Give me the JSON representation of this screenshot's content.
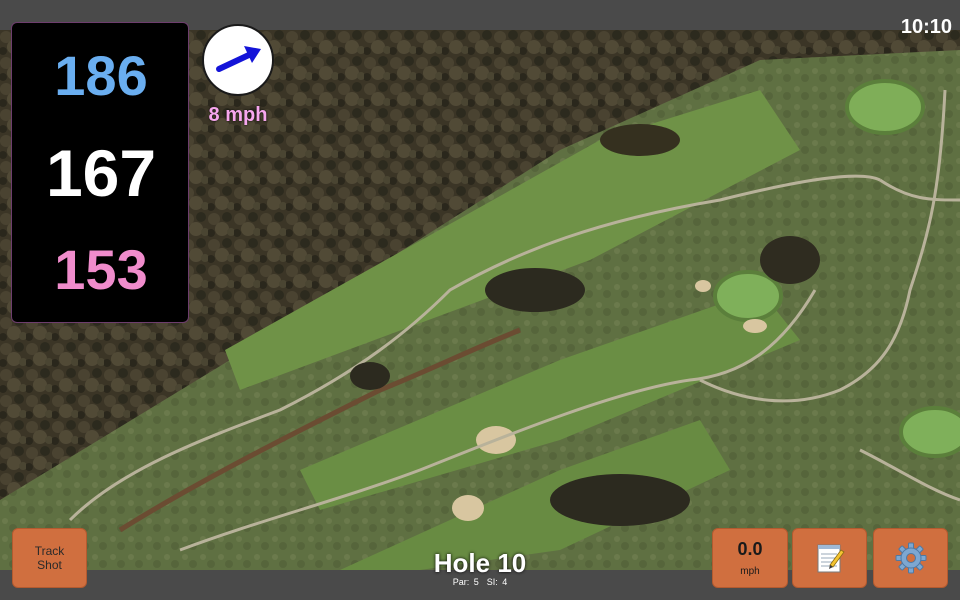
{
  "status": {
    "time": "10:10"
  },
  "distances": {
    "back": "186",
    "middle": "167",
    "front": "153"
  },
  "wind": {
    "speed": "8 mph",
    "direction_icon": "arrow-icon"
  },
  "hole": {
    "title": "Hole 10",
    "par": "Par: 5",
    "si": "SI: 4"
  },
  "buttons": {
    "track_line1": "Track",
    "track_line2": "Shot",
    "speed_value": "0.0",
    "speed_unit": "mph",
    "notes_icon": "notepad-icon",
    "settings_icon": "gear-icon"
  },
  "colors": {
    "back_distance": "#6aaef0",
    "middle_distance": "#ffffff",
    "front_distance": "#f08ccc",
    "wind_text": "#f7a7ee",
    "button": "#d06f3f",
    "wind_arrow": "#1414d8"
  }
}
